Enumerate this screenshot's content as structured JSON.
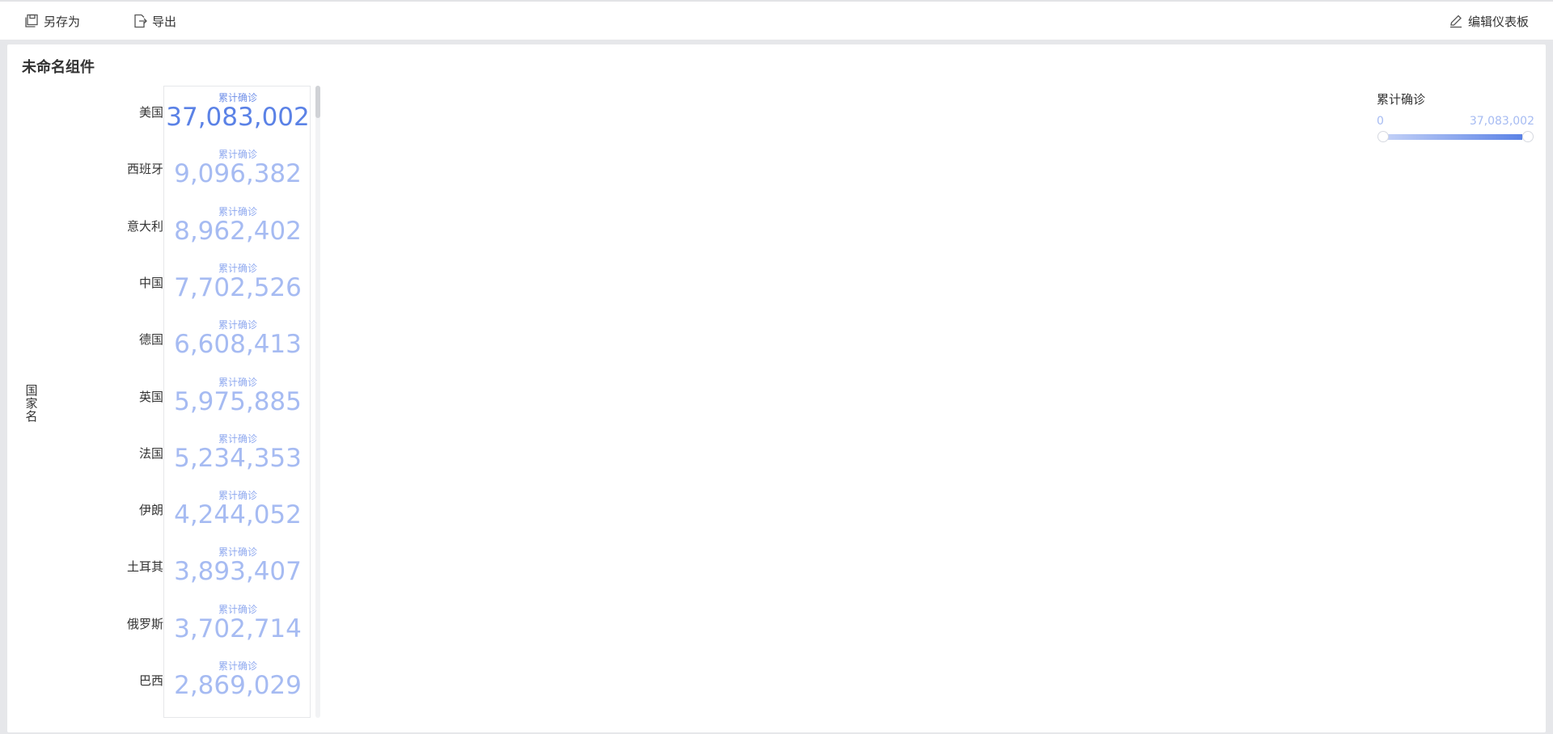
{
  "toolbar": {
    "save_as_label": "另存为",
    "export_label": "导出",
    "edit_dashboard_label": "编辑仪表板"
  },
  "widget": {
    "title": "未命名组件",
    "y_axis_label": "国家名",
    "card_subtitle": "累计确诊"
  },
  "legend": {
    "title": "累计确诊",
    "min": "0",
    "max": "37,083,002",
    "gradient": [
      "#c4d2f7",
      "#5b82e6"
    ]
  },
  "rows": [
    {
      "country": "美国",
      "value": "37,083,002",
      "sub": "累计确诊"
    },
    {
      "country": "西班牙",
      "value": "9,096,382",
      "sub": "累计确诊"
    },
    {
      "country": "意大利",
      "value": "8,962,402",
      "sub": "累计确诊"
    },
    {
      "country": "中国",
      "value": "7,702,526",
      "sub": "累计确诊"
    },
    {
      "country": "德国",
      "value": "6,608,413",
      "sub": "累计确诊"
    },
    {
      "country": "英国",
      "value": "5,975,885",
      "sub": "累计确诊"
    },
    {
      "country": "法国",
      "value": "5,234,353",
      "sub": "累计确诊"
    },
    {
      "country": "伊朗",
      "value": "4,244,052",
      "sub": "累计确诊"
    },
    {
      "country": "土耳其",
      "value": "3,893,407",
      "sub": "累计确诊"
    },
    {
      "country": "俄罗斯",
      "value": "3,702,714",
      "sub": "累计确诊"
    },
    {
      "country": "巴西",
      "value": "2,869,029",
      "sub": "累计确诊"
    }
  ],
  "colors": {
    "accent": "#5b82e6",
    "light_value": "#a6bbf2"
  }
}
